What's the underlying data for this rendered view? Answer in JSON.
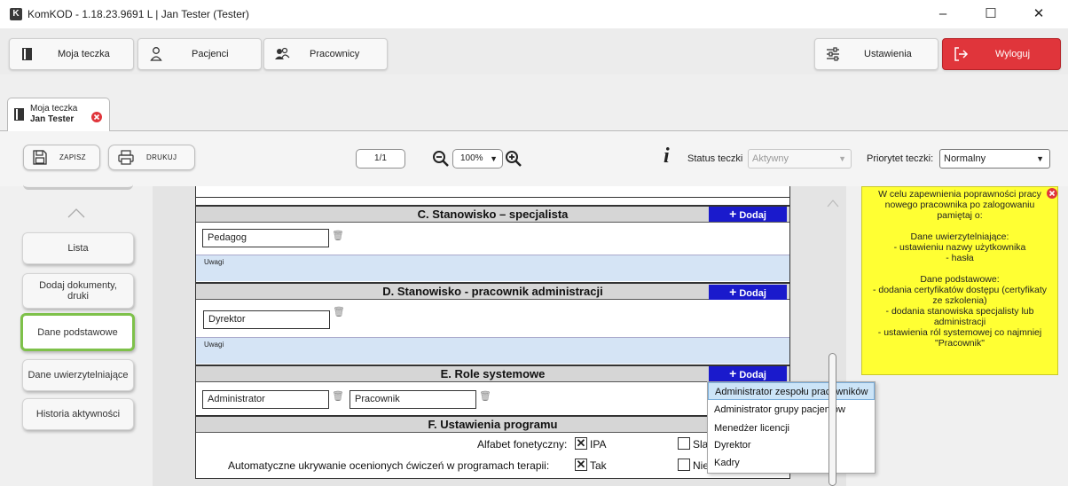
{
  "window": {
    "app_icon_letter": "K",
    "title": "KomKOD - 1.18.23.9691 L | Jan Tester (Tester)",
    "minimize": "–",
    "maximize": "☐",
    "close": "✕"
  },
  "topnav": {
    "my_folder": "Moja teczka",
    "patients": "Pacjenci",
    "employees": "Pracownicy",
    "settings": "Ustawienia",
    "logout": "Wyloguj"
  },
  "tab": {
    "line1": "Moja teczka",
    "line2": "Jan Tester"
  },
  "toolbar": {
    "save": "ZAPISZ",
    "print": "DRUKUJ",
    "page": "1/1",
    "zoom": "100%",
    "status_label": "Status teczki",
    "status_value": "Aktywny",
    "priority_label": "Priorytet teczki:",
    "priority_value": "Normalny"
  },
  "sidebar": {
    "items": [
      "Lista",
      "Dodaj dokumenty, druki",
      "Dane podstawowe",
      "Dane uwierzytelniające",
      "Historia aktywności"
    ],
    "active_index": 2
  },
  "document": {
    "add_label": "Dodaj",
    "remarks_label": "Uwagi",
    "section_c": {
      "title": "C. Stanowisko – specjalista",
      "value": "Pedagog"
    },
    "section_d": {
      "title": "D. Stanowisko - pracownik administracji",
      "value": "Dyrektor"
    },
    "section_e": {
      "title": "E. Role systemowe",
      "values": [
        "Administrator",
        "Pracownik"
      ]
    },
    "section_f": {
      "title": "F. Ustawienia programu",
      "rows": [
        {
          "label": "Alfabet fonetyczny:",
          "opt1": "IPA",
          "opt1_checked": true,
          "opt2": "Sla"
        },
        {
          "label": "Automatyczne ukrywanie ocenionych ćwiczeń w programach terapii:",
          "opt1": "Tak",
          "opt1_checked": true,
          "opt2": "Nie"
        }
      ]
    }
  },
  "role_dropdown": {
    "items": [
      "Administrator zespołu pracowników",
      "Administrator grupy pacjentów",
      "Menedżer licencji",
      "Dyrektor",
      "Kadry"
    ],
    "highlighted_index": 0
  },
  "note": {
    "paragraphs": [
      "W celu zapewnienia poprawności pracy nowego pracownika po zalogowaniu pamiętaj o:",
      "Dane uwierzytelniające:\n- ustawieniu nazwy użytkownika\n- hasła",
      "Dane podstawowe:\n- dodania certyfikatów dostępu (certyfikaty ze szkolenia)\n- dodania stanowiska specjalisty lub administracji\n- ustawienia ról systemowej co najmniej \"Pracownik\""
    ]
  },
  "colors": {
    "logout_red": "#e0353b",
    "add_blue": "#1a1acc",
    "note_yellow": "#ffff33",
    "active_green": "#7ec14a",
    "remarks_blue": "#d5e4f5"
  }
}
